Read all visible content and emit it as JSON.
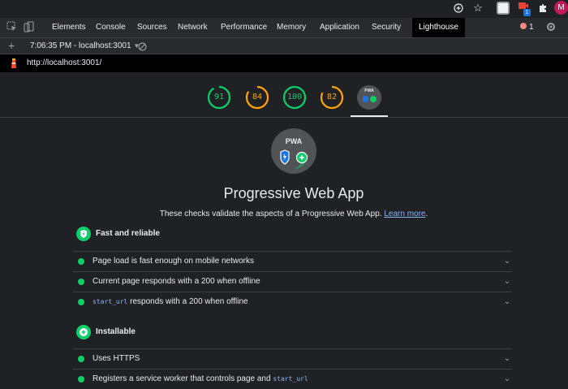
{
  "browser": {
    "avatar_initial": "M",
    "extension_badge": "1"
  },
  "devtools": {
    "tabs": [
      "Elements",
      "Console",
      "Sources",
      "Network",
      "Performance",
      "Memory",
      "Application",
      "Security",
      "Lighthouse"
    ],
    "active_tab": "Lighthouse",
    "error_count": "1",
    "report_selector": "7:06:35 PM - localhost:3001",
    "url": "http://localhost:3001/"
  },
  "scores": [
    {
      "value": "91",
      "color": "#0cce6b",
      "fraction": 0.91
    },
    {
      "value": "84",
      "color": "#ffa400",
      "fraction": 0.84
    },
    {
      "value": "100",
      "color": "#0cce6b",
      "fraction": 1.0
    },
    {
      "value": "82",
      "color": "#ffa400",
      "fraction": 0.82
    }
  ],
  "pwa_badge_text": "PWA",
  "colors": {
    "pass": "#0cce6b",
    "average": "#ffa400",
    "link": "#8ab4f8",
    "background": "#202124"
  },
  "category": {
    "title": "Progressive Web App",
    "description": "These checks validate the aspects of a Progressive Web App.",
    "learn_more": "Learn more"
  },
  "groups": [
    {
      "label": "Fast and reliable",
      "audits": [
        {
          "label": "Page load is fast enough on mobile networks"
        },
        {
          "label": "Current page responds with a 200 when offline"
        },
        {
          "code": "start_url",
          "label": "responds with a 200 when offline"
        }
      ]
    },
    {
      "label": "Installable",
      "audits": [
        {
          "label": "Uses HTTPS"
        },
        {
          "label": "Registers a service worker that controls page and",
          "code": "start_url"
        }
      ]
    }
  ]
}
